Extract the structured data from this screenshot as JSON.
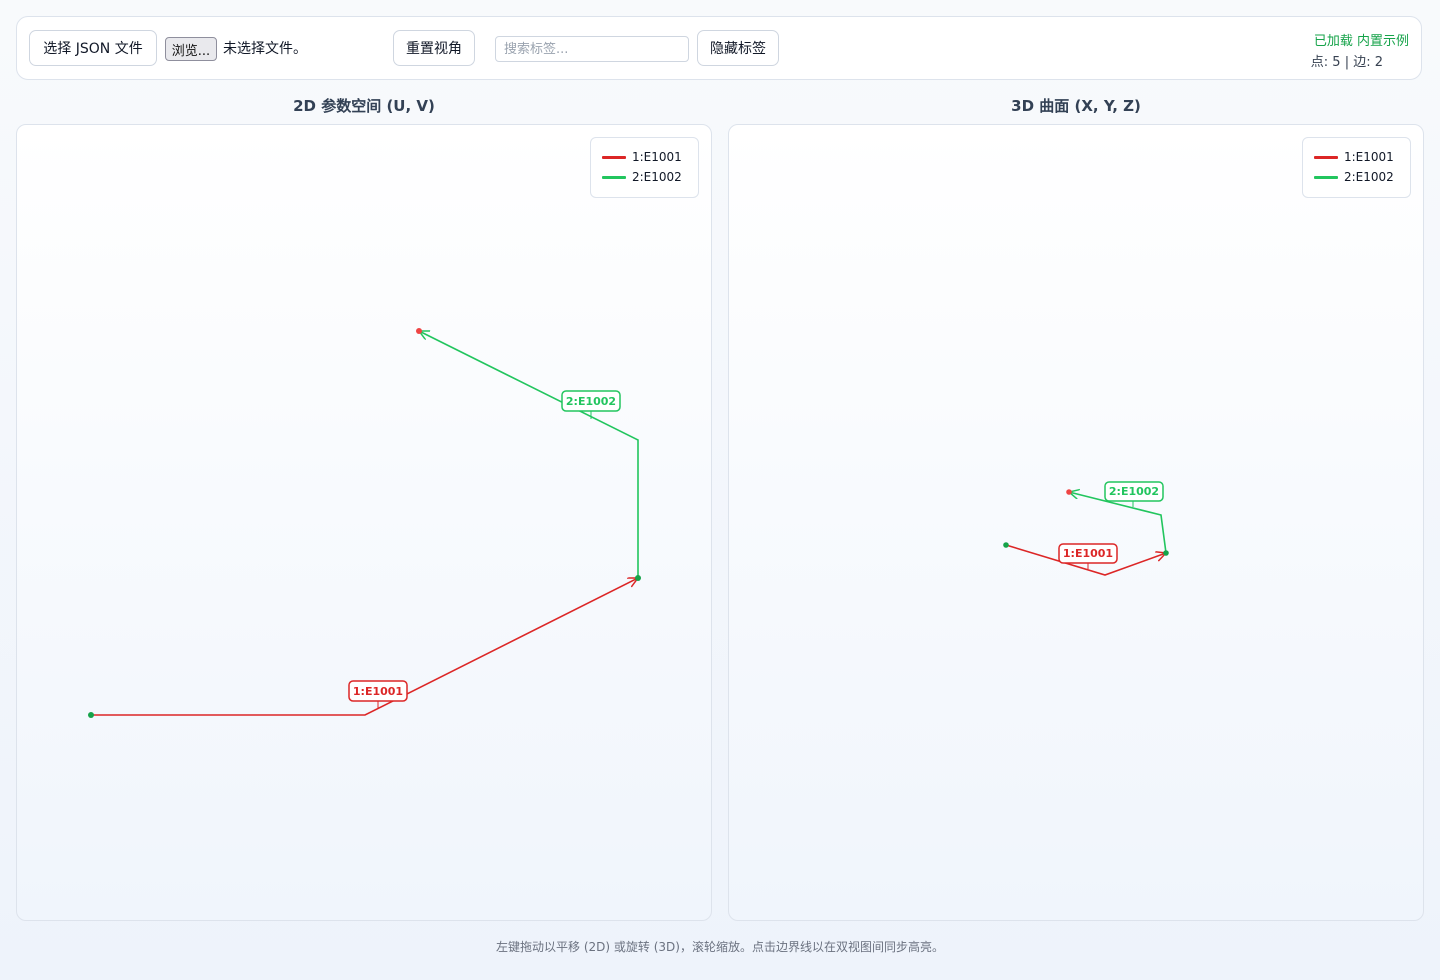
{
  "toolbar": {
    "choose_json_label": "选择 JSON 文件",
    "browse_label": "浏览...",
    "no_file_text": "未选择文件。",
    "reset_view_label": "重置视角",
    "search_placeholder": "搜索标签...",
    "hide_labels_label": "隐藏标签",
    "status_loaded": "已加载 内置示例",
    "status_counts": "点: 5 | 边: 2"
  },
  "panel2d": {
    "title": "2D 参数空间 (U, V)",
    "legend": [
      {
        "label": "1:E1001",
        "color": "#dc2626"
      },
      {
        "label": "2:E1002",
        "color": "#22c55e"
      }
    ],
    "edge_labels": [
      "1:E1001",
      "2:E1002"
    ]
  },
  "panel3d": {
    "title": "3D 曲面 (X, Y, Z)",
    "legend": [
      {
        "label": "1:E1001",
        "color": "#dc2626"
      },
      {
        "label": "2:E1002",
        "color": "#22c55e"
      }
    ],
    "edge_labels": [
      "1:E1001",
      "2:E1002"
    ]
  },
  "colors": {
    "edge1": "#dc2626",
    "edge2": "#22c55e",
    "start_point": "#16a34a",
    "end_point": "#ef4444",
    "status_ok": "#16a34a"
  },
  "footer": {
    "hint": "左键拖动以平移 (2D) 或旋转 (3D)，滚轮缩放。点击边界线以在双视图间同步高亮。"
  }
}
